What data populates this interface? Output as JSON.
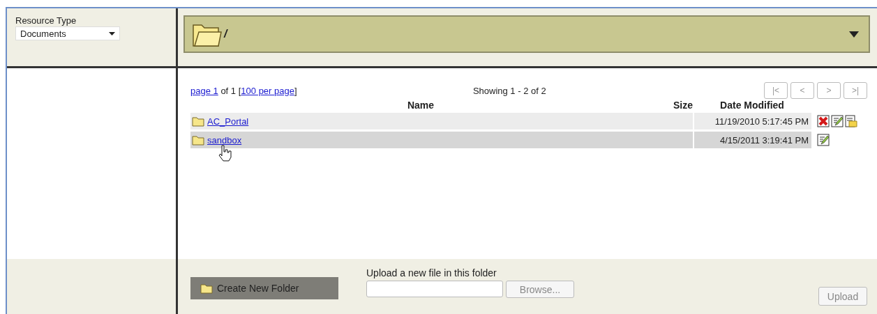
{
  "resource_type": {
    "label": "Resource Type",
    "value": "Documents"
  },
  "path_bar": {
    "path": "/"
  },
  "pager": {
    "page_link": "page 1",
    "of_text": "of 1",
    "bracket_open": "[",
    "per_page_link": "100 per page",
    "bracket_close": "]",
    "showing": "Showing 1 - 2 of 2",
    "buttons": [
      {
        "label": "|<",
        "disabled": true
      },
      {
        "label": "<",
        "disabled": true
      },
      {
        "label": ">",
        "disabled": true
      },
      {
        "label": ">|",
        "disabled": true
      }
    ]
  },
  "table": {
    "columns": [
      "Name",
      "Size",
      "Date Modified"
    ],
    "rows": [
      {
        "name": "AC_Portal",
        "date_modified": "11/19/2010 5:17:45 PM",
        "selected": false,
        "actions": [
          {
            "kind": "delete"
          },
          {
            "kind": "edit"
          },
          {
            "kind": "properties"
          }
        ]
      },
      {
        "name": "sandbox",
        "date_modified": "4/15/2011 3:19:41 PM",
        "selected": true,
        "actions": [
          {
            "kind": "edit"
          }
        ]
      }
    ]
  },
  "create_folder_button": {
    "label": "Create New Folder"
  },
  "upload": {
    "label": "Upload a new file in this folder",
    "browse_button": {
      "label": "Browse..."
    },
    "upload_button": {
      "label": "Upload",
      "disabled": true
    }
  }
}
